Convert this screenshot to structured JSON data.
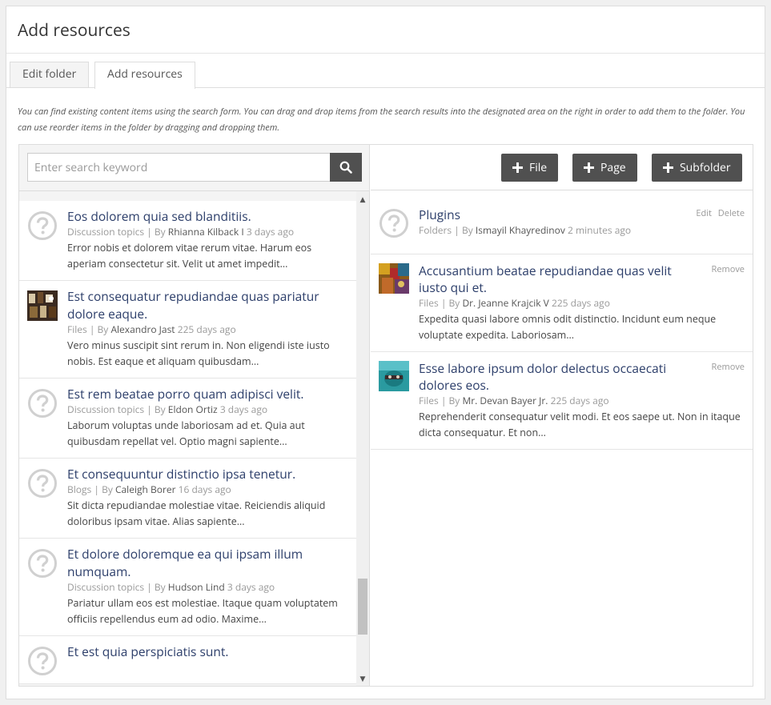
{
  "page": {
    "title": "Add resources",
    "intro": "You can find existing content items using the search form. You can drag and drop items from the search results into the designated area on the right in order to add them to the folder. You can use reorder items in the folder by dragging and dropping them."
  },
  "tabs": [
    {
      "label": "Edit folder"
    },
    {
      "label": "Add resources"
    }
  ],
  "search": {
    "placeholder": "Enter search keyword"
  },
  "toolbar": {
    "file": "File",
    "page": "Page",
    "subfolder": "Subfolder"
  },
  "results": [
    {
      "title": "Eos dolorem quia sed blanditiis.",
      "type": "Discussion topics",
      "by": "By",
      "author": "Rhianna Kilback I",
      "time": "3 days ago",
      "desc": "Error nobis et dolorem vitae rerum vitae. Harum eos aperiam consectetur sit. Velit ut amet impedit..."
    },
    {
      "title": "Est consequatur repudiandae quas pariatur dolore eaque.",
      "type": "Files",
      "by": "By",
      "author": "Alexandro Jast",
      "time": "225 days ago",
      "desc": "Vero minus suscipit sint rerum in. Non eligendi iste iusto nobis. Est eaque et aliquam quibusdam..."
    },
    {
      "title": "Est rem beatae porro quam adipisci velit.",
      "type": "Discussion topics",
      "by": "By",
      "author": "Eldon Ortiz",
      "time": "3 days ago",
      "desc": "Laborum voluptas unde laboriosam ad et. Quia aut quibusdam repellat vel. Optio magni sapiente..."
    },
    {
      "title": "Et consequuntur distinctio ipsa tenetur.",
      "type": "Blogs",
      "by": "By",
      "author": "Caleigh Borer",
      "time": "16 days ago",
      "desc": "Sit dicta repudiandae molestiae vitae. Reiciendis aliquid doloribus ipsam vitae. Alias sapiente..."
    },
    {
      "title": "Et dolore doloremque ea qui ipsam illum numquam.",
      "type": "Discussion topics",
      "by": "By",
      "author": "Hudson Lind",
      "time": "3 days ago",
      "desc": "Pariatur ullam eos est molestiae. Itaque quam voluptatem officiis repellendus eum ad odio. Maxime..."
    },
    {
      "title": "Et est quia perspiciatis sunt.",
      "type": "",
      "by": "",
      "author": "",
      "time": "",
      "desc": ""
    }
  ],
  "folder_items": [
    {
      "title": "Plugins",
      "type": "Folders",
      "by": "By",
      "author": "Ismayil Khayredinov",
      "time": "2 minutes ago",
      "desc": "",
      "edit": "Edit",
      "delete": "Delete"
    },
    {
      "title": "Accusantium beatae repudiandae quas velit iusto qui et.",
      "type": "Files",
      "by": "By",
      "author": "Dr. Jeanne Krajcik V",
      "time": "225 days ago",
      "desc": "Expedita quasi labore omnis odit distinctio. Incidunt eum neque voluptate expedita. Laboriosam...",
      "remove": "Remove"
    },
    {
      "title": "Esse labore ipsum dolor delectus occaecati dolores eos.",
      "type": "Files",
      "by": "By",
      "author": "Mr. Devan Bayer Jr.",
      "time": "225 days ago",
      "desc": "Reprehenderit consequatur velit modi. Et eos saepe ut. Non in itaque dicta consequatur. Et non...",
      "remove": "Remove"
    }
  ],
  "scroll": {
    "position": 0.95
  },
  "icons": {
    "search": "search-icon",
    "unknown": "question-icon",
    "plus": "plus-icon"
  }
}
